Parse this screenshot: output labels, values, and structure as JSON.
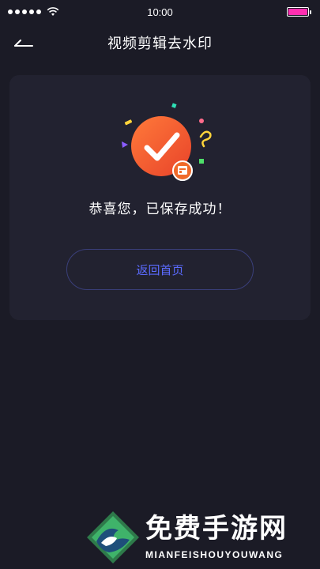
{
  "status_bar": {
    "time": "10:00",
    "battery_level": 1.0,
    "battery_color": "#ff2fb0"
  },
  "nav": {
    "back_icon": "back-arrow-icon",
    "title": "视频剪辑去水印"
  },
  "success": {
    "icon": "check-circle-icon",
    "badge_icon": "gallery-badge-icon",
    "message": "恭喜您，已保存成功！",
    "accent_color": "#f25a2a"
  },
  "actions": {
    "home_label": "返回首页",
    "home_color": "#5b6bff"
  },
  "watermark": {
    "title": "免费手游网",
    "subtitle": "MIANFEISHOUYOUWANG"
  }
}
